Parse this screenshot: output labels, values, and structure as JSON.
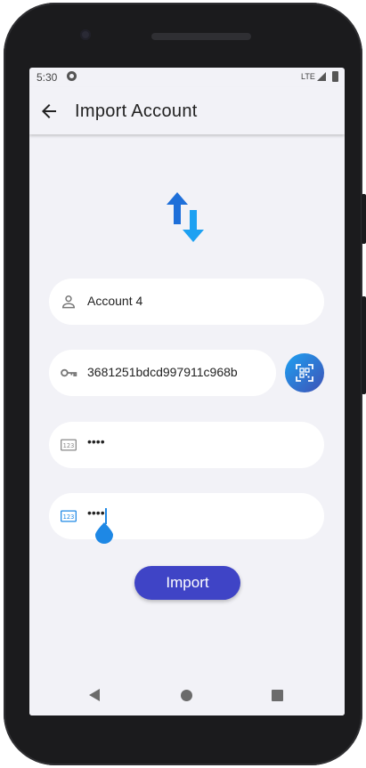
{
  "status_bar": {
    "time": "5:30",
    "network": "LTE"
  },
  "app_bar": {
    "title": "Import Account"
  },
  "form": {
    "account_name": {
      "value": "Account 4"
    },
    "private_key": {
      "value": "3681251bdcd997911c968b"
    },
    "password": {
      "value": "••••"
    },
    "confirm_password": {
      "value": "••••"
    }
  },
  "import_button": {
    "label": "Import"
  },
  "colors": {
    "accent": "#3f44c6",
    "swap_up": "#1e6fd9",
    "swap_down": "#1da1f2",
    "focused": "#1e88e5",
    "background": "#f2f2f7"
  },
  "icons": {
    "back": "arrow-left-icon",
    "swap": "swap-vertical-icon",
    "account": "person-icon",
    "key": "key-icon",
    "qr": "qr-scan-icon",
    "password": "numeric-icon"
  }
}
